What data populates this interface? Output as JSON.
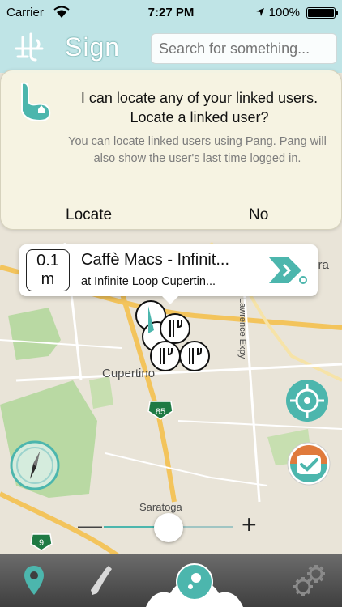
{
  "status_bar": {
    "carrier": "Carrier",
    "time": "7:27 PM",
    "battery": "100%"
  },
  "header": {
    "title": "Sign",
    "search_placeholder": "Search for something..."
  },
  "alert": {
    "title": "I can locate any of your linked users. Locate a linked user?",
    "message": "You can locate linked users using Pang. Pang will also show the user's last time logged in.",
    "locate_label": "Locate",
    "no_label": "No"
  },
  "callout": {
    "distance_value": "0.1",
    "distance_unit": "m",
    "title": "Caffè Macs - Infinit...",
    "subtitle": "at Infinite Loop Cupertin..."
  },
  "map": {
    "labels": {
      "cupertino": "Cupertino",
      "santa_clara": "Clara",
      "lawrence": "Lawrence Expy",
      "saratoga": "Saratoga",
      "highway_85": "85",
      "highway_9": "9"
    }
  },
  "zoom": {
    "minus": "—",
    "plus": "+",
    "level": 0.5
  },
  "colors": {
    "accent": "#4cb6ad",
    "map_bg": "#e9e4d8",
    "park": "#b9d9a3",
    "road": "#f3c45c",
    "tabbar": "#4f4f4f"
  },
  "tabs": [
    {
      "name": "map-pin-icon"
    },
    {
      "name": "phone-icon"
    },
    {
      "name": "chat-bubble-icon"
    },
    {
      "name": "gear-icon"
    }
  ]
}
